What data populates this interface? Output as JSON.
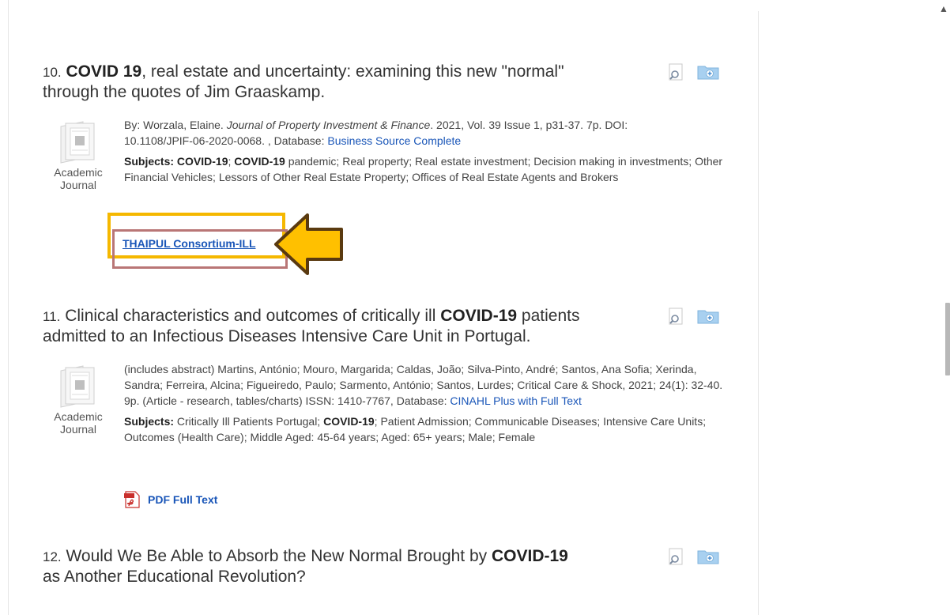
{
  "results": [
    {
      "number": "10.",
      "title_bold": "COVID 19",
      "title_rest_line1": ", real estate and uncertainty: examining this new \"normal\"",
      "title_line2": "through the quotes of Jim Graaskamp.",
      "byline_1": "By: Worzala, Elaine. ",
      "journal": "Journal of Property Investment & Finance",
      "byline_2": ". 2021, Vol. 39 Issue 1, p31-37. 7p. DOI:",
      "byline_3": "10.1108/JPIF-06-2020-0068. , Database: ",
      "database": "Business Source Complete",
      "subjects_label": "Subjects:",
      "subj_a": "COVID-19",
      "subj_sep": "; ",
      "subj_b": "COVID-19",
      "subj_rest": " pandemic; Real property; Real estate investment; Decision making in investments; Other Financial Vehicles; Lessors of Other Real Estate Property; Offices of Real Estate Agents and Brokers",
      "type_line1": "Academic",
      "type_line2": "Journal",
      "link_label": "THAIPUL Consortium-ILL"
    },
    {
      "number": "11.",
      "title_pre": "Clinical characteristics and outcomes of critically ill ",
      "title_bold": "COVID-19",
      "title_post": " patients",
      "title_line2": "admitted to an Infectious Diseases Intensive Care Unit in Portugal.",
      "details": "(includes abstract) Martins, António; Mouro, Margarida; Caldas, João; Silva-Pinto, André; Santos, Ana Sofia; Xerinda, Sandra; Ferreira, Alcina; Figueiredo, Paulo; Sarmento, António; Santos, Lurdes; Critical Care & Shock, 2021; 24(1): 32-40. 9p. (Article - research, tables/charts) ISSN: 1410-7767, Database: ",
      "database": "CINAHL Plus with Full Text",
      "subjects_label": "Subjects:",
      "subj_a": "Critically Ill Patients Portugal; ",
      "subj_b": "COVID-19",
      "subj_rest": "; Patient Admission; Communicable Diseases; Intensive Care Units; Outcomes (Health Care); Middle Aged: 45-64 years; Aged: 65+ years; Male; Female",
      "type_line1": "Academic",
      "type_line2": "Journal",
      "pdf_label": "PDF Full Text"
    },
    {
      "number": "12.",
      "title_pre": "Would We Be Able to Absorb the New Normal Brought by ",
      "title_bold": "COVID-19",
      "title_line2": "as Another Educational Revolution?"
    }
  ],
  "icons": {
    "preview": "magnifier-preview-icon",
    "folder": "add-to-folder-icon",
    "doc": "academic-journal-icon",
    "pdf": "pdf-icon",
    "arrow": "callout-arrow-icon"
  },
  "colors": {
    "link": "#1a56b8",
    "highlight_yellow": "#f5b800",
    "highlight_box": "#b97676",
    "arrow_fill": "#ffc000",
    "arrow_stroke": "#5a3a10"
  }
}
